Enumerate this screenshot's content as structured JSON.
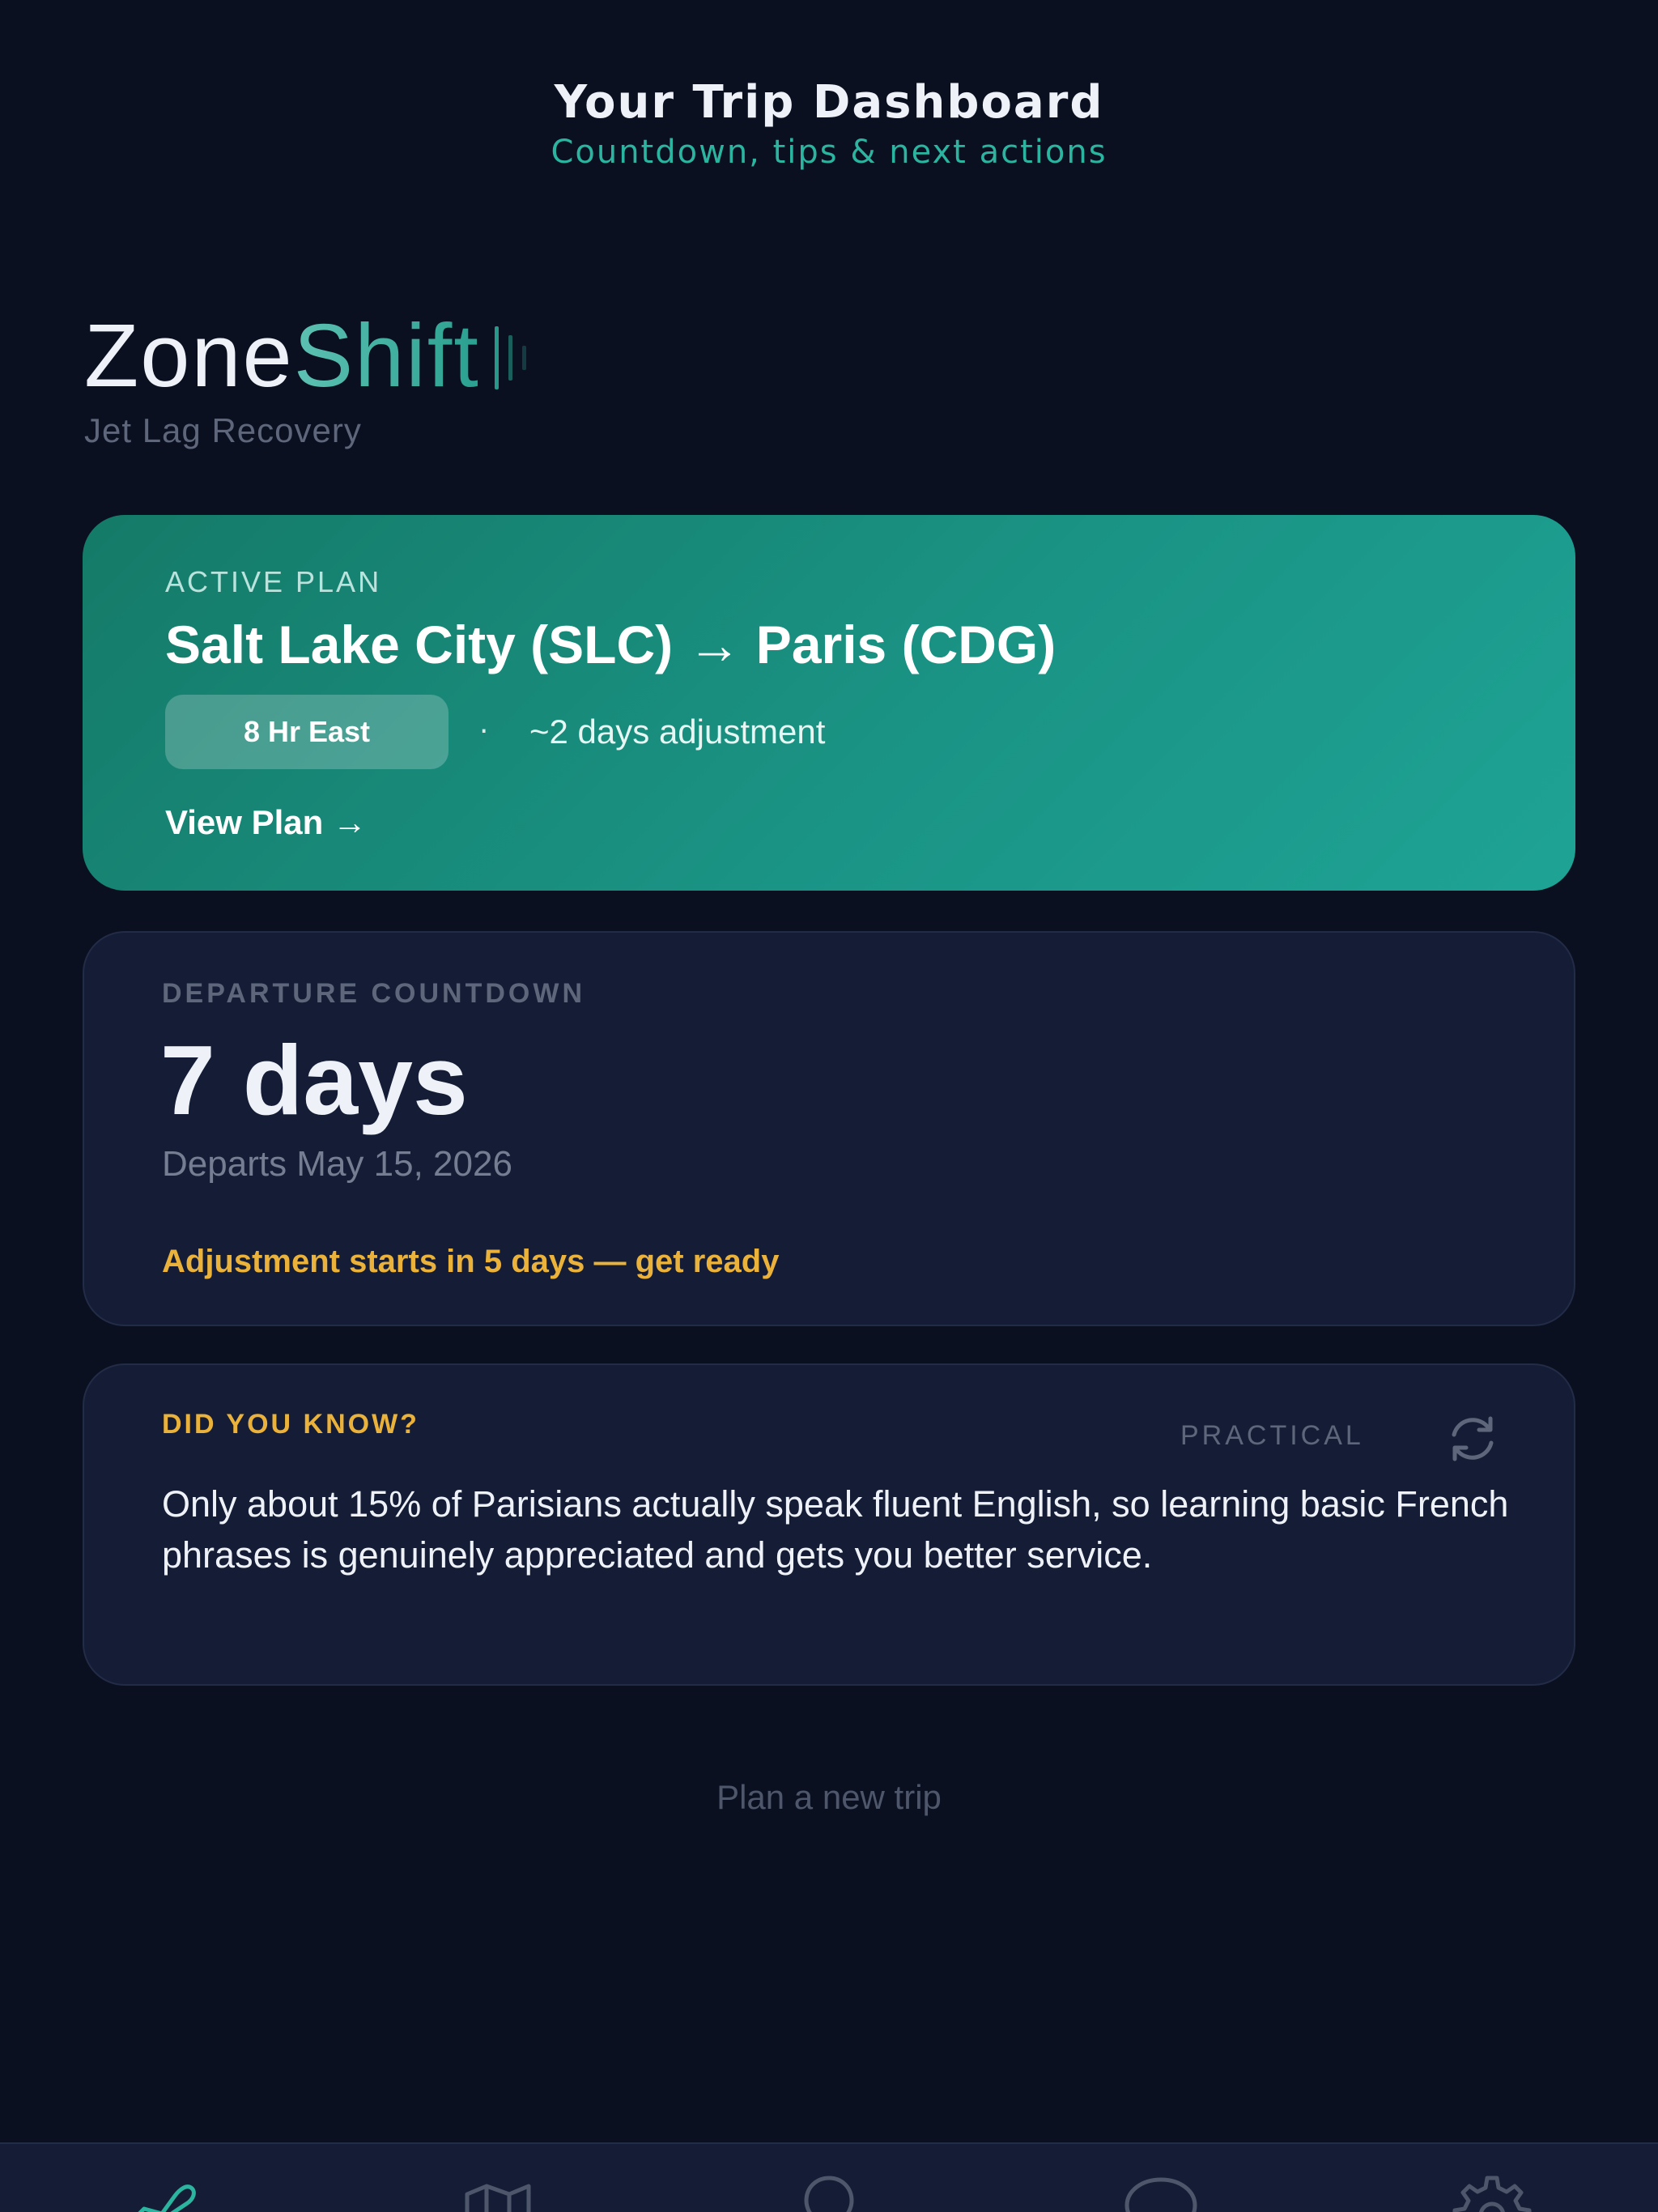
{
  "header": {
    "title": "Your Trip Dashboard",
    "subtitle": "Countdown, tips & next actions"
  },
  "brand": {
    "name_part1": "Zone",
    "name_part2": "Shift",
    "tagline": "Jet Lag Recovery",
    "accent_color": "#2bb5a0"
  },
  "active_plan": {
    "kicker": "ACTIVE PLAN",
    "route": "Salt Lake City (SLC) → Paris (CDG)",
    "badge": "8 Hr East",
    "separator": "·",
    "adjustment": "~2 days adjustment",
    "link": "View Plan →",
    "gradient": [
      "#157a68",
      "#1ea395"
    ]
  },
  "countdown": {
    "kicker": "DEPARTURE COUNTDOWN",
    "value": "7 days",
    "date": "Departs May 15, 2026",
    "alert": "Adjustment starts in 5 days — get ready",
    "alert_color": "#eab23a"
  },
  "fact": {
    "kicker": "DID YOU KNOW?",
    "category": "PRACTICAL",
    "text": "Only about 15% of Parisians actually speak fluent English, so learning basic French phrases is genuinely appreciated and gets you better service.",
    "refresh_icon": "refresh-icon"
  },
  "footer": {
    "new_trip": "Plan a new trip"
  },
  "tabbar": {
    "tabs": [
      {
        "icon": "plane-icon",
        "active": true
      },
      {
        "icon": "map-icon",
        "active": false
      },
      {
        "icon": "lightbulb-icon",
        "active": false
      },
      {
        "icon": "chat-icon",
        "active": false
      },
      {
        "icon": "gear-icon",
        "active": false
      }
    ],
    "active_color": "#2bb5a0",
    "inactive_color": "#4d566b"
  }
}
